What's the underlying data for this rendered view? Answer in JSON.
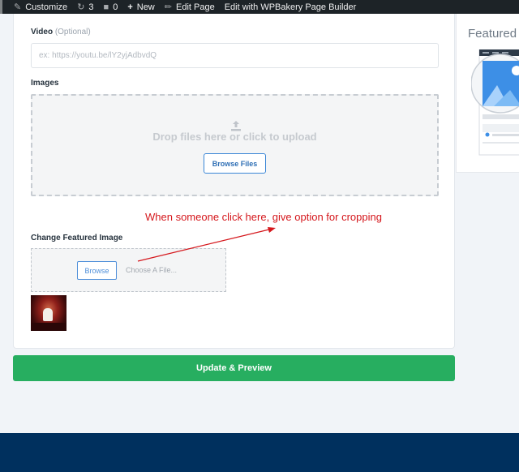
{
  "admin_bar": {
    "customize": "Customize",
    "updates_count": "3",
    "comments_count": "0",
    "new_label": "New",
    "edit_page": "Edit Page",
    "wpbakery": "Edit with WPBakery Page Builder"
  },
  "form": {
    "video": {
      "label": "Video",
      "optional": "(Optional)",
      "placeholder": "ex: https://youtu.be/lY2yjAdbvdQ",
      "value": ""
    },
    "images": {
      "label": "Images",
      "drop_message": "Drop files here or click to upload",
      "browse_button": "Browse Files"
    },
    "annotation": "When someone click here, give option for cropping",
    "featured": {
      "label": "Change Featured Image",
      "browse_button": "Browse",
      "choose_text": "Choose A File..."
    },
    "submit": "Update & Preview"
  },
  "side_panel": {
    "title": "Featured"
  },
  "colors": {
    "primary_green": "#27ae60",
    "footer_navy": "#00305e",
    "annotation_red": "#d5171c",
    "link_blue": "#3a86d6"
  }
}
